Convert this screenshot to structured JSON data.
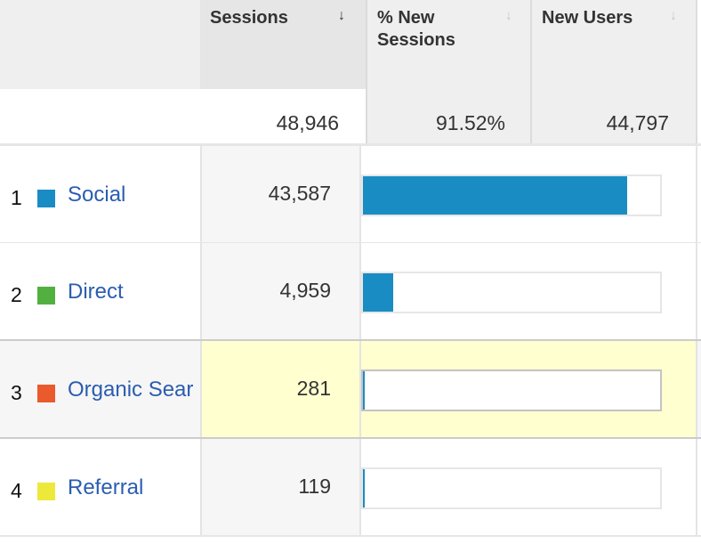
{
  "header": {
    "columns": [
      {
        "label": "",
        "sortable": false
      },
      {
        "label": "Sessions",
        "sort_icon": "sort-desc-icon",
        "active": true
      },
      {
        "label": "% New Sessions",
        "label_line1": "% New",
        "label_line2": "Sessions",
        "sort_icon": "sort-desc-icon",
        "active": false
      },
      {
        "label": "New Users",
        "sort_icon": "sort-desc-icon",
        "active": false
      }
    ]
  },
  "totals": {
    "sessions": "48,946",
    "pct_new_sessions": "91.52%",
    "new_users": "44,797"
  },
  "rows": [
    {
      "rank": "1",
      "name": "Social",
      "swatch_color": "#1a8cc4",
      "sessions": "43,587",
      "share": 0.8905,
      "highlighted": false
    },
    {
      "rank": "2",
      "name": "Direct",
      "swatch_color": "#52b040",
      "sessions": "4,959",
      "share": 0.1013,
      "highlighted": false
    },
    {
      "rank": "3",
      "name": "Organic Sear",
      "swatch_color": "#ea5a2c",
      "sessions": "281",
      "share": 0.0057,
      "highlighted": true
    },
    {
      "rank": "4",
      "name": "Referral",
      "swatch_color": "#ede93a",
      "sessions": "119",
      "share": 0.0024,
      "highlighted": false
    }
  ],
  "colors": {
    "link": "#2a5db0",
    "bar": "#1a8cc4",
    "highlight": "#ffffd0",
    "header_bg": "#efefef",
    "active_header_bg": "#e6e6e6"
  }
}
